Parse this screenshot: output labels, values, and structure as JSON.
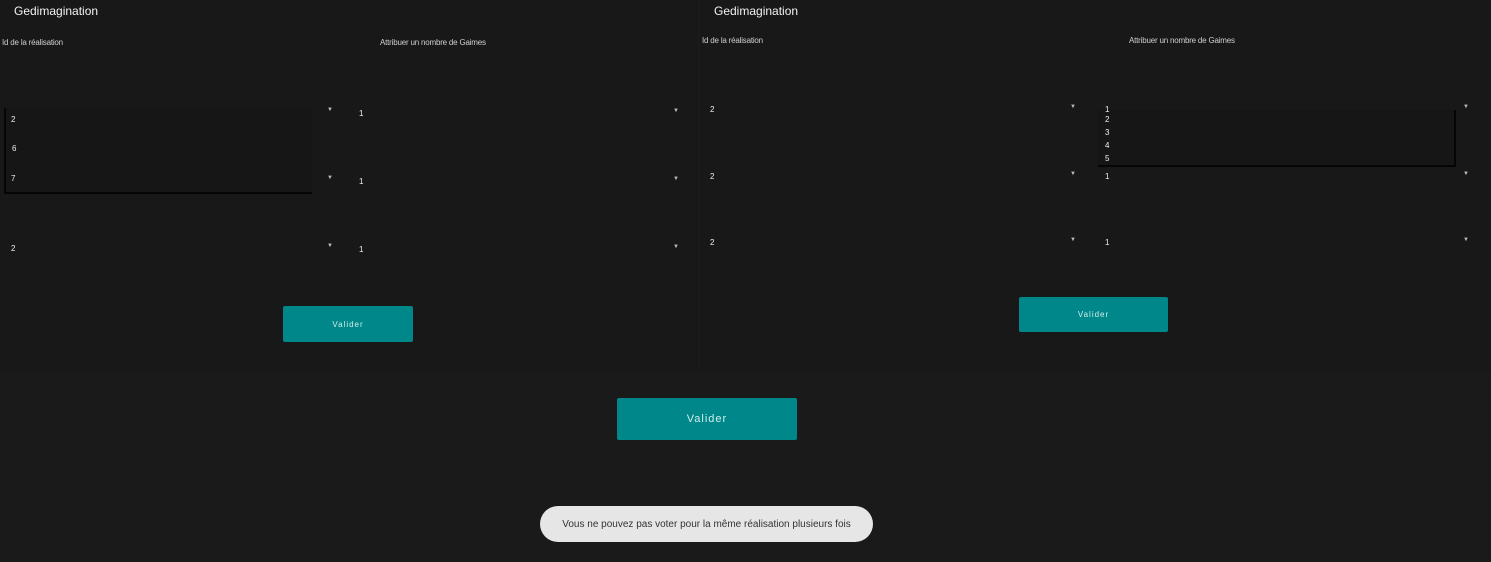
{
  "left": {
    "title": "Gedimagination",
    "col_id_label": "Id de la réalisation",
    "col_votes_label": "Attribuer un nombre de Gaimes",
    "rows": [
      {
        "id": "2",
        "votes": "1"
      },
      {
        "id": "7",
        "votes": "1"
      },
      {
        "id": "2",
        "votes": "1"
      }
    ],
    "dropdown_options": [
      "6"
    ],
    "button_label": "Valider"
  },
  "right": {
    "title": "Gedimagination",
    "col_id_label": "Id de la réalisation",
    "col_votes_label": "Attribuer un nombre de Gaimes",
    "rows": [
      {
        "id": "2",
        "votes": "1"
      },
      {
        "id": "2",
        "votes": "1"
      },
      {
        "id": "2",
        "votes": "1"
      }
    ],
    "dropdown_options": [
      "2",
      "3",
      "4",
      "5"
    ],
    "button_label": "Valider"
  },
  "main_button_label": "Valider",
  "toast": "Vous ne pouvez pas voter pour la même réalisation plusieurs fois",
  "icons": {
    "spinner_arrow": "dropdown-arrow-icon"
  },
  "colors": {
    "background": "#1a1a1a",
    "accent": "#00878a",
    "toast_bg": "#e6e6e6"
  }
}
